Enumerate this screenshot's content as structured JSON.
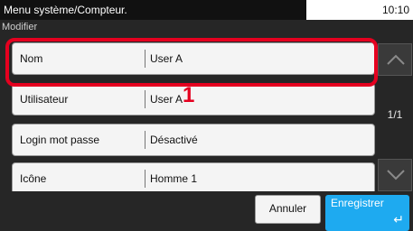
{
  "header": {
    "title": "Menu système/Compteur.",
    "time": "10:10"
  },
  "subtitle": "Modifier",
  "rows": [
    {
      "label": "Nom",
      "value": "User A"
    },
    {
      "label": "Utilisateur",
      "value": "User A"
    },
    {
      "label": "Login mot passe",
      "value": "Désactivé"
    },
    {
      "label": "Icône",
      "value": "Homme 1"
    }
  ],
  "callout_number": "1",
  "pager": "1/1",
  "footer": {
    "cancel": "Annuler",
    "save": "Enregistrer"
  },
  "icons": {
    "scroll_up": "chevron-up-icon",
    "scroll_down": "chevron-down-icon",
    "enter": "enter-arrow-icon"
  },
  "colors": {
    "highlight": "#e5001f",
    "accent": "#1eaaf0",
    "panel": "#262626"
  }
}
